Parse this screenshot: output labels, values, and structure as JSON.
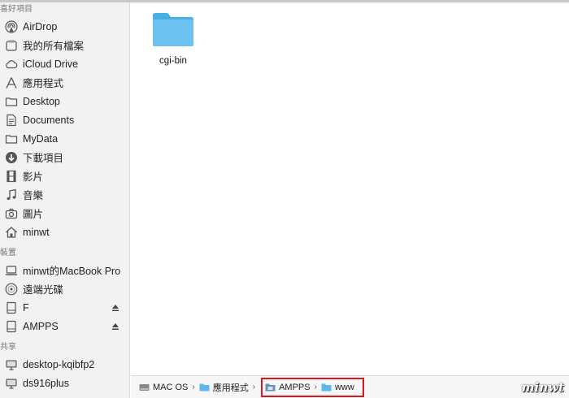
{
  "sidebar": {
    "favorites_header": "喜好項目",
    "favorites": [
      {
        "label": "AirDrop",
        "icon": "airdrop-icon"
      },
      {
        "label": "我的所有檔案",
        "icon": "all-files-icon"
      },
      {
        "label": "iCloud Drive",
        "icon": "cloud-icon"
      },
      {
        "label": "應用程式",
        "icon": "applications-icon"
      },
      {
        "label": "Desktop",
        "icon": "folder-icon"
      },
      {
        "label": "Documents",
        "icon": "documents-icon"
      },
      {
        "label": "MyData",
        "icon": "folder-icon"
      },
      {
        "label": "下載項目",
        "icon": "download-icon"
      },
      {
        "label": "影片",
        "icon": "film-icon"
      },
      {
        "label": "音樂",
        "icon": "music-icon"
      },
      {
        "label": "圖片",
        "icon": "camera-icon"
      },
      {
        "label": "minwt",
        "icon": "home-icon"
      }
    ],
    "devices_header": "裝置",
    "devices": [
      {
        "label": "minwt的MacBook Pro",
        "icon": "laptop-icon"
      },
      {
        "label": "遠端光碟",
        "icon": "disc-icon"
      },
      {
        "label": "F",
        "icon": "drive-icon",
        "eject": true
      },
      {
        "label": "AMPPS",
        "icon": "drive-icon",
        "eject": true
      }
    ],
    "shared_header": "共享",
    "shared": [
      {
        "label": "desktop-kqibfp2",
        "icon": "monitor-icon"
      },
      {
        "label": "ds916plus",
        "icon": "monitor-icon"
      }
    ]
  },
  "content": {
    "items": [
      {
        "label": "cgi-bin",
        "icon": "folder-icon"
      }
    ]
  },
  "pathbar": {
    "crumbs": [
      "MAC OS",
      "應用程式",
      "AMPPS",
      "www"
    ],
    "separator": "›"
  },
  "watermark": "minwt",
  "colors": {
    "folder": "#5fb8ec",
    "highlight": "#e0141c"
  }
}
